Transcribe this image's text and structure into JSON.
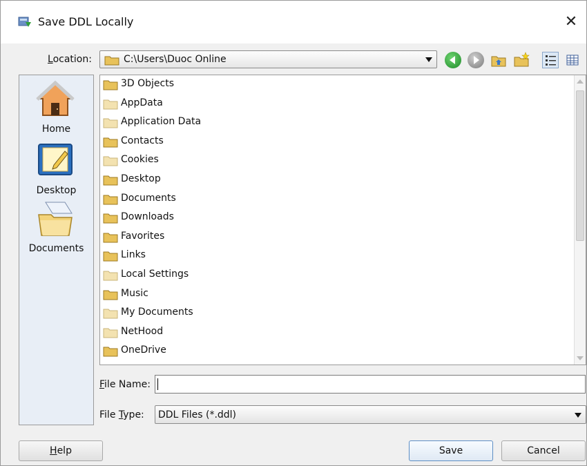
{
  "window": {
    "title": "Save DDL Locally",
    "close_glyph": "✕"
  },
  "location": {
    "label_mnemonic": "L",
    "label_rest": "ocation:",
    "value": "C:\\Users\\Duoc Online"
  },
  "toolbar": {
    "icons": [
      "back-icon",
      "forward-icon",
      "up-folder-icon",
      "new-folder-icon",
      "list-view-icon",
      "details-view-icon"
    ],
    "selected_view": "list-view"
  },
  "places": [
    {
      "label": "Home",
      "icon": "home-icon"
    },
    {
      "label": "Desktop",
      "icon": "desktop-icon"
    },
    {
      "label": "Documents",
      "icon": "documents-icon"
    }
  ],
  "files": [
    {
      "name": "3D Objects",
      "style": "normal"
    },
    {
      "name": "AppData",
      "style": "hidden"
    },
    {
      "name": "Application Data",
      "style": "hidden"
    },
    {
      "name": "Contacts",
      "style": "normal"
    },
    {
      "name": "Cookies",
      "style": "hidden"
    },
    {
      "name": "Desktop",
      "style": "normal"
    },
    {
      "name": "Documents",
      "style": "normal"
    },
    {
      "name": "Downloads",
      "style": "normal"
    },
    {
      "name": "Favorites",
      "style": "normal"
    },
    {
      "name": "Links",
      "style": "normal"
    },
    {
      "name": "Local Settings",
      "style": "hidden"
    },
    {
      "name": "Music",
      "style": "normal"
    },
    {
      "name": "My Documents",
      "style": "hidden"
    },
    {
      "name": "NetHood",
      "style": "hidden"
    },
    {
      "name": "OneDrive",
      "style": "normal"
    }
  ],
  "file_name": {
    "label_mnemonic": "F",
    "label_rest": "ile Name:",
    "value": ""
  },
  "file_type": {
    "label_prefix": "File ",
    "label_mnemonic": "T",
    "label_rest": "ype:",
    "value": "DDL Files (*.ddl)"
  },
  "buttons": {
    "help_mnemonic": "H",
    "help_rest": "elp",
    "save": "Save",
    "cancel": "Cancel"
  },
  "colors": {
    "folder_normal": "#e8c25a",
    "folder_hidden": "#f3e2b0",
    "accent_green": "#1f8a2a",
    "selected_view_bg": "#dce8f5"
  }
}
